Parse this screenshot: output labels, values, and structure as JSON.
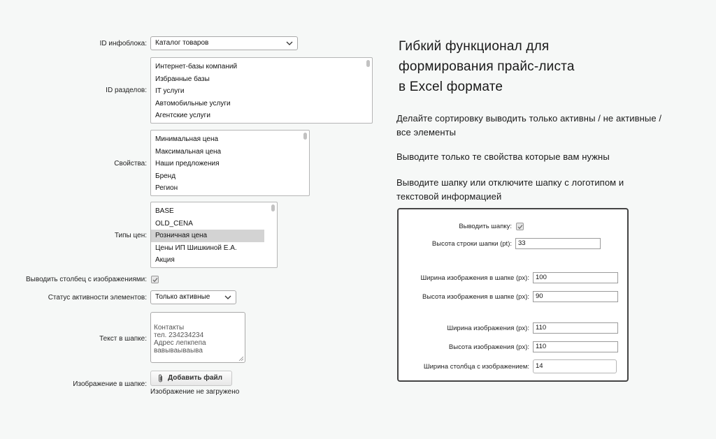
{
  "form": {
    "iblock_id": {
      "label": "ID инфоблока:",
      "value": "Каталог товаров"
    },
    "sections": {
      "label": "ID разделов:",
      "options": [
        "Интернет-базы компаний",
        "Избранные базы",
        "IT услуги",
        "Автомобильные услуги",
        "Агентские услуги"
      ]
    },
    "properties": {
      "label": "Свойства:",
      "options": [
        "Минимальная цена",
        "Максимальная цена",
        "Наши предложения",
        "Бренд",
        "Регион"
      ]
    },
    "price_types": {
      "label": "Типы цен:",
      "options": [
        "BASE",
        "OLD_CENA",
        "Розничная цена",
        "Цены ИП Шишкиной Е.А.",
        "Акция"
      ],
      "selected": "Розничная цена"
    },
    "image_column": {
      "label": "Выводить столбец с изображениями:",
      "checked": true
    },
    "activity_status": {
      "label": "Статус активности элементов:",
      "value": "Только активные"
    },
    "header_text": {
      "label": "Текст в шапке:",
      "value": "Контакты\nтел. 234234234\nАдрес лепкпепа\nвавываываыва"
    },
    "header_image": {
      "label": "Изображение в шапке:",
      "button_label": "Добавить файл",
      "status": "Изображение не загружено"
    }
  },
  "promo": {
    "heading": "Гибкий функционал для\nформирования прайс-листа\nв Excel формате",
    "paragraphs": [
      "Делайте сортировку выводить только активны / не активные / все элементы",
      "Выводите только те свойства которые вам нужны",
      "Выводите шапку или отключите шапку с логотипом и текстовой информацией"
    ]
  },
  "panel": {
    "show_header": {
      "label": "Выводить шапку:",
      "checked": true
    },
    "header_row_height": {
      "label": "Высота строки шапки (pt):",
      "value": "33"
    },
    "header_image_width": {
      "label": "Ширина изображения в шапке (px):",
      "value": "100"
    },
    "header_image_height": {
      "label": "Высота изображения в шапке (px):",
      "value": "90"
    },
    "image_width": {
      "label": "Ширина изображения (px):",
      "value": "110"
    },
    "image_height": {
      "label": "Высота изображения (px):",
      "value": "110"
    },
    "image_column_width": {
      "label": "Ширина столбца с изображением:",
      "value": "14"
    }
  },
  "icons": {
    "chevron": "chevron-down-icon",
    "check": "check-icon",
    "clip": "paperclip-icon",
    "resize": "resize-handle-icon"
  },
  "colors": {
    "background": "#f6f8f7",
    "selected_option": "#d3d3d3",
    "panel_border": "#444444"
  }
}
